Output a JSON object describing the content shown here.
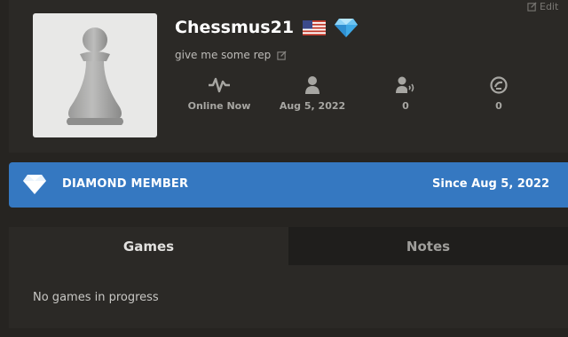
{
  "profile": {
    "edit_label": "Edit",
    "username": "Chessmus21",
    "status_text": "give me some rep",
    "avatar_icon": "pawn-icon",
    "flag_icon": "us-flag-icon",
    "membership_icon": "diamond-icon"
  },
  "stats": [
    {
      "icon": "activity-icon",
      "value": "Online Now"
    },
    {
      "icon": "person-icon",
      "value": "Aug 5, 2022"
    },
    {
      "icon": "followers-icon",
      "value": "0"
    },
    {
      "icon": "points-icon",
      "value": "0"
    }
  ],
  "banner": {
    "label": "DIAMOND MEMBER",
    "since": "Since Aug 5, 2022",
    "color": "#3578c1"
  },
  "tabs": [
    {
      "label": "Games",
      "active": true
    },
    {
      "label": "Notes",
      "active": false
    }
  ],
  "games": {
    "empty_message": "No games in progress"
  }
}
